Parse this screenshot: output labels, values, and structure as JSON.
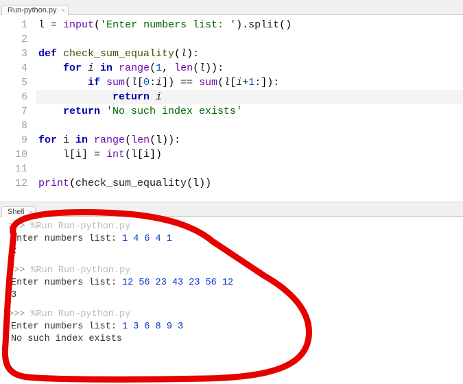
{
  "editor_tab": {
    "label": "Run-python.py"
  },
  "shell_tab": {
    "label": "Shell"
  },
  "gutter": [
    "1",
    "2",
    "3",
    "4",
    "5",
    "6",
    "7",
    "8",
    "9",
    "10",
    "11",
    "12"
  ],
  "code": {
    "l1": {
      "a": "l ",
      "b": "=",
      "c": " input",
      "d": "(",
      "e": "'Enter numbers list: '",
      "f": ")",
      "g": ".",
      "h": "split",
      "i": "()"
    },
    "l3": {
      "a": "def",
      "b": " check_sum_equality",
      "c": "(",
      "d": "l",
      "e": "):"
    },
    "l4": {
      "a": "    ",
      "b": "for",
      "c": " i ",
      "d": "in",
      "e": " range",
      "f": "(",
      "g": "1",
      "h": ", ",
      "i": "len",
      "j": "(",
      "k": "l",
      "l": ")):"
    },
    "l5": {
      "a": "        ",
      "b": "if",
      "c": " sum",
      "d": "(",
      "e": "l",
      "f": "[",
      "g": "0",
      "h": ":",
      "i": "i",
      "j": "]) ",
      "k": "==",
      "l": " sum",
      "m": "(",
      "n": "l",
      "o": "[",
      "p": "i",
      "q": "+",
      "r": "1",
      "s": ":]):"
    },
    "l6": {
      "a": "            ",
      "b": "return",
      "c": " i"
    },
    "l7": {
      "a": "    ",
      "b": "return",
      "c": " 'No such index exists'"
    },
    "l9": {
      "a": "for",
      "b": " i ",
      "c": "in",
      "d": " range",
      "e": "(",
      "f": "len",
      "g": "(l)):"
    },
    "l10": {
      "a": "    l[i] ",
      "b": "=",
      "c": " int",
      "d": "(l[i])"
    },
    "l12": {
      "a": "print",
      "b": "(",
      "c": "check_sum_equality",
      "d": "(l))"
    }
  },
  "shell": {
    "prompt": ">>> ",
    "run": "%Run Run-python.py",
    "ask": "Enter numbers list: ",
    "r1_in": "1 4 6 4 1",
    "r1_out": "2",
    "r2_in": "12 56 23 43 23 56 12",
    "r2_out": "3",
    "r3_in": "1 3 6 8 9 3",
    "r3_out": "No such index exists"
  }
}
